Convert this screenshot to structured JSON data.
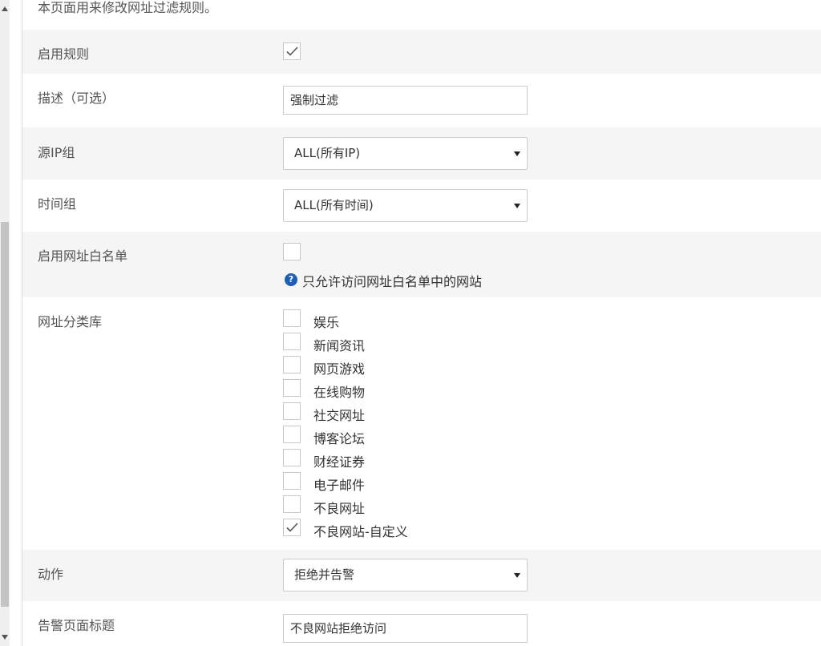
{
  "notice": "本页面用来修改网址过滤规则。",
  "enable_rule": {
    "label": "启用规则",
    "checked": true
  },
  "description": {
    "label": "描述（可选）",
    "value": "强制过滤"
  },
  "source_ip_group": {
    "label": "源IP组",
    "selected": "ALL(所有IP)"
  },
  "time_group": {
    "label": "时间组",
    "selected": "ALL(所有时间)"
  },
  "whitelist": {
    "label": "启用网址白名单",
    "checked": false,
    "help": "只允许访问网址白名单中的网站"
  },
  "url_categories": {
    "label": "网址分类库",
    "items": [
      {
        "label": "娱乐",
        "checked": false
      },
      {
        "label": "新闻资讯",
        "checked": false
      },
      {
        "label": "网页游戏",
        "checked": false
      },
      {
        "label": "在线购物",
        "checked": false
      },
      {
        "label": "社交网址",
        "checked": false
      },
      {
        "label": "博客论坛",
        "checked": false
      },
      {
        "label": "财经证券",
        "checked": false
      },
      {
        "label": "电子邮件",
        "checked": false
      },
      {
        "label": "不良网址",
        "checked": false
      },
      {
        "label": "不良网站-自定义",
        "checked": true
      }
    ]
  },
  "action": {
    "label": "动作",
    "selected": "拒绝并告警"
  },
  "alert_title": {
    "label": "告警页面标题",
    "value": "不良网站拒绝访问"
  },
  "icons": {
    "check": "check-icon",
    "caret": "caret-down-icon",
    "help": "question-circle-icon"
  },
  "colors": {
    "help_icon": "#1a5fb4",
    "row_shade": "#f5f5f5",
    "check_mark": "#555555"
  }
}
